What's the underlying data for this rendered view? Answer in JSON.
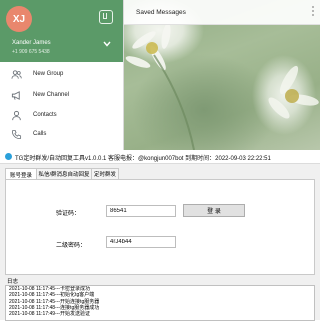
{
  "telegram": {
    "avatar_initials": "XJ",
    "user_name": "Xander James",
    "user_phone": "+1 909 675 5438",
    "chat_title": "Saved Messages",
    "menu": [
      {
        "label": "New Group",
        "icon": "group-icon"
      },
      {
        "label": "New Channel",
        "icon": "megaphone-icon"
      },
      {
        "label": "Contacts",
        "icon": "person-icon"
      },
      {
        "label": "Calls",
        "icon": "phone-icon"
      }
    ],
    "colors": {
      "header": "#5b9a68",
      "avatar": "#e9876d"
    }
  },
  "tool": {
    "window_title": "TG定时群发/自动回复工具v1.0.0.1  客服电报：@kongjun007bot    到期时间：2022-09-03 22:22:51",
    "tabs": [
      "账号登录",
      "私信/群消息自动回复",
      "定时群发"
    ],
    "active_tab": 0,
    "code_label": "验证码：",
    "code_value": "86541",
    "login_button": "登 录",
    "password_label": "二级密码：",
    "password_value": "4rJ4b44",
    "log_title": "日志",
    "log_lines": [
      "2021-10-08 11:17:45---卡密登录成功",
      "2021-10-08 11:17:45---初始化tg客户端",
      "2021-10-08 11:17:45---开始连接tg服务器",
      "2021-10-08 11:17:48---连接tg服务器成功",
      "2021-10-08 11:17:49---开始发送验证"
    ]
  }
}
